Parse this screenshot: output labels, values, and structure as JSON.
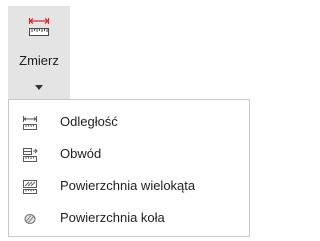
{
  "ribbon": {
    "measure": {
      "label": "Zmierz",
      "icon": "ruler-measure-icon"
    }
  },
  "menu": {
    "items": [
      {
        "label": "Odległość",
        "icon": "distance-icon"
      },
      {
        "label": "Obwód",
        "icon": "perimeter-icon"
      },
      {
        "label": "Powierzchnia wielokąta",
        "icon": "polygon-area-icon"
      },
      {
        "label": "Powierzchnia koła",
        "icon": "circle-area-icon"
      }
    ]
  },
  "colors": {
    "button_hover_bg": "#e4e4e4",
    "accent_red": "#d62e2e",
    "icon_gray": "#5a5a5a",
    "menu_border": "#c7c7c7"
  }
}
